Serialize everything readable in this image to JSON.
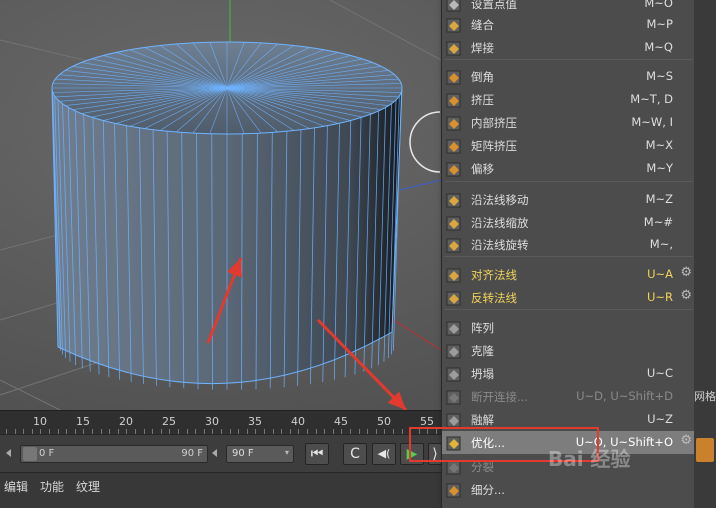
{
  "timeline": {
    "ticks": [
      "10",
      "15",
      "20",
      "25",
      "30",
      "35",
      "40",
      "45",
      "50",
      "55"
    ],
    "start_field": "0 F",
    "slider_end": "90 F",
    "end_field": "90 F"
  },
  "transport": {
    "first_frame": "⏮",
    "loop": "C",
    "prev_key": "◀(",
    "play": "▶",
    "next": "⟩"
  },
  "bottom_menu": [
    "编辑",
    "功能",
    "纹理"
  ],
  "context_menu": {
    "items": [
      {
        "label": "设置点值",
        "shortcut": "M~O",
        "icon": "set-point-icon",
        "style": "normal"
      },
      {
        "label": "缝合",
        "shortcut": "M~P",
        "icon": "stitch-icon",
        "style": "normal"
      },
      {
        "label": "焊接",
        "shortcut": "M~Q",
        "icon": "weld-icon",
        "style": "normal"
      },
      {
        "label": "倒角",
        "shortcut": "M~S",
        "icon": "bevel-icon",
        "style": "normal"
      },
      {
        "label": "挤压",
        "shortcut": "M~T, D",
        "icon": "extrude-icon",
        "style": "normal"
      },
      {
        "label": "内部挤压",
        "shortcut": "M~W, I",
        "icon": "extrude-inner-icon",
        "style": "normal"
      },
      {
        "label": "矩阵挤压",
        "shortcut": "M~X",
        "icon": "matrix-extrude-icon",
        "style": "normal"
      },
      {
        "label": "偏移",
        "shortcut": "M~Y",
        "icon": "smooth-shift-icon",
        "style": "normal"
      },
      {
        "label": "沿法线移动",
        "shortcut": "M~Z",
        "icon": "normal-move-icon",
        "style": "normal"
      },
      {
        "label": "沿法线缩放",
        "shortcut": "M~#",
        "icon": "normal-scale-icon",
        "style": "normal"
      },
      {
        "label": "沿法线旋转",
        "shortcut": "M~,",
        "icon": "normal-rotate-icon",
        "style": "normal"
      },
      {
        "label": "对齐法线",
        "shortcut": "U~A",
        "icon": "align-normals-icon",
        "style": "yellow",
        "gear": true
      },
      {
        "label": "反转法线",
        "shortcut": "U~R",
        "icon": "reverse-normals-icon",
        "style": "yellow",
        "gear": true
      },
      {
        "label": "阵列",
        "shortcut": "",
        "icon": "array-icon",
        "style": "normal"
      },
      {
        "label": "克隆",
        "shortcut": "",
        "icon": "clone-icon",
        "style": "normal"
      },
      {
        "label": "坍塌",
        "shortcut": "U~C",
        "icon": "collapse-icon",
        "style": "normal"
      },
      {
        "label": "断开连接...",
        "shortcut": "U~D, U~Shift+D",
        "icon": "disconnect-icon",
        "style": "dis"
      },
      {
        "label": "融解",
        "shortcut": "U~Z",
        "icon": "melt-icon",
        "style": "normal"
      },
      {
        "label": "优化...",
        "shortcut": "U~O, U~Shift+O",
        "icon": "optimize-icon",
        "style": "hl",
        "gear": true
      },
      {
        "label": "分裂",
        "shortcut": "",
        "icon": "split-icon",
        "style": "dis"
      },
      {
        "label": "细分...",
        "shortcut": "",
        "icon": "subdivide-icon",
        "style": "normal"
      }
    ]
  },
  "right_panel": {
    "label": "网格"
  },
  "watermark": "Bai 经验",
  "colors": {
    "highlight": "#7d7d7d",
    "yellow_item": "#f2d35a",
    "annotation_red": "#e23a2e",
    "wire_blue": "#6fb3ff"
  }
}
